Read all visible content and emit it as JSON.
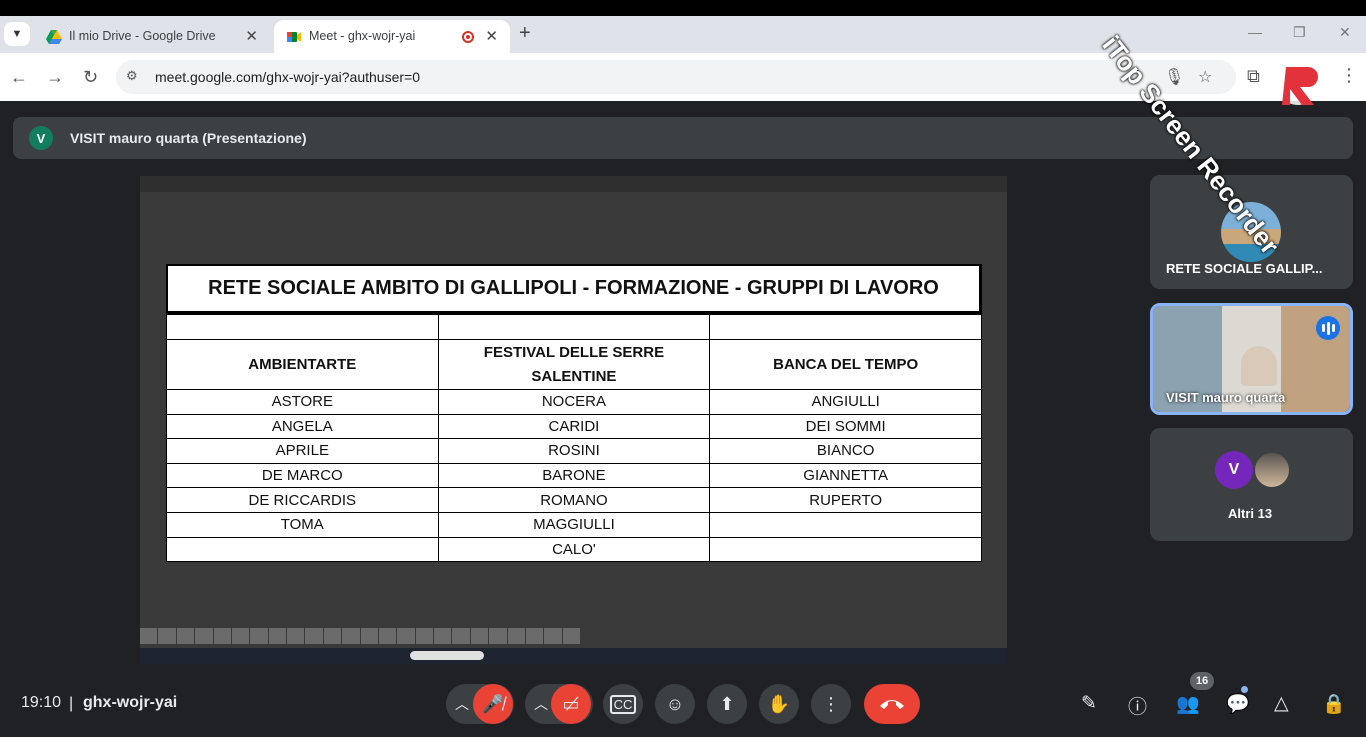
{
  "browser": {
    "tabs": [
      {
        "title": "Il mio Drive - Google Drive",
        "icon": "google-drive-icon"
      },
      {
        "title": "Meet - ghx-wojr-yai",
        "icon": "google-meet-icon",
        "recording": true
      }
    ],
    "url": "meet.google.com/ghx-wojr-yai?authuser=0"
  },
  "meeting": {
    "presenter_initial": "V",
    "presentation_title": "VISIT mauro quarta (Presentazione)",
    "time": "19:10",
    "code": "ghx-wojr-yai",
    "participant_count": "16"
  },
  "sheet": {
    "title": "RETE SOCIALE AMBITO DI GALLIPOLI - FORMAZIONE - GRUPPI DI LAVORO",
    "headers": [
      "AMBIENTARTE",
      "FESTIVAL DELLE SERRE SALENTINE",
      "BANCA DEL TEMPO"
    ],
    "header2_line1": "FESTIVAL DELLE SERRE",
    "header2_line2": "SALENTINE",
    "rows": [
      [
        "ASTORE",
        "NOCERA",
        "ANGIULLI"
      ],
      [
        "ANGELA",
        "CARIDI",
        "DEI SOMMI"
      ],
      [
        "APRILE",
        "ROSINI",
        "BIANCO"
      ],
      [
        "DE MARCO",
        "BARONE",
        "GIANNETTA"
      ],
      [
        "DE RICCARDIS",
        "ROMANO",
        "RUPERTO"
      ],
      [
        "TOMA",
        "MAGGIULLI",
        ""
      ],
      [
        "",
        "CALO'",
        ""
      ]
    ]
  },
  "tiles": [
    {
      "label": "RETE SOCIALE GALLIP..."
    },
    {
      "label": "VISIT mauro quarta"
    },
    {
      "label": "Altri 13",
      "initial": "V"
    }
  ],
  "watermark": "iTop Screen Recorder",
  "colors": {
    "accent": "#8ab4f8",
    "danger": "#ea4335",
    "panel": "#3c4043",
    "bg": "#202124"
  }
}
